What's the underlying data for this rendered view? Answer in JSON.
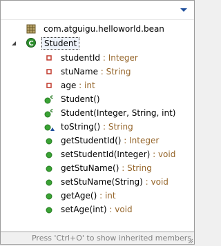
{
  "toolbar": {
    "menu_icon": "view-menu-triangle-icon"
  },
  "tree": {
    "package": {
      "label": "com.atguigu.helloworld.bean",
      "icon": "package-import-icon"
    },
    "class": {
      "label": "Student",
      "icon": "class-icon",
      "expanded": true,
      "twisty": "expanded-arrow-icon"
    },
    "members": [
      {
        "name": "studentId",
        "type": " : Integer",
        "icon": "private-field-icon"
      },
      {
        "name": "stuName",
        "type": " : String",
        "icon": "private-field-icon"
      },
      {
        "name": "age",
        "type": " : int",
        "icon": "private-field-icon"
      },
      {
        "name": "Student()",
        "type": "",
        "icon": "public-constructor-icon"
      },
      {
        "name": "Student(Integer, String, int)",
        "type": "",
        "icon": "public-constructor-icon"
      },
      {
        "name": "toString()",
        "type": " : String",
        "icon": "public-override-method-icon"
      },
      {
        "name": "getStudentId()",
        "type": " : Integer",
        "icon": "public-method-icon"
      },
      {
        "name": "setStudentId(Integer)",
        "type": " : void",
        "icon": "public-method-icon"
      },
      {
        "name": "getStuName()",
        "type": " : String",
        "icon": "public-method-icon"
      },
      {
        "name": "setStuName(String)",
        "type": " : void",
        "icon": "public-method-icon"
      },
      {
        "name": "getAge()",
        "type": " : int",
        "icon": "public-method-icon"
      },
      {
        "name": "setAge(int)",
        "type": " : void",
        "icon": "public-method-icon"
      }
    ]
  },
  "status": {
    "text": "Press 'Ctrl+O' to show inherited members"
  },
  "colors": {
    "type_text": "#95652a",
    "field_icon": "#c0392b",
    "method_icon": "#3aa335",
    "status_text": "#808080"
  }
}
